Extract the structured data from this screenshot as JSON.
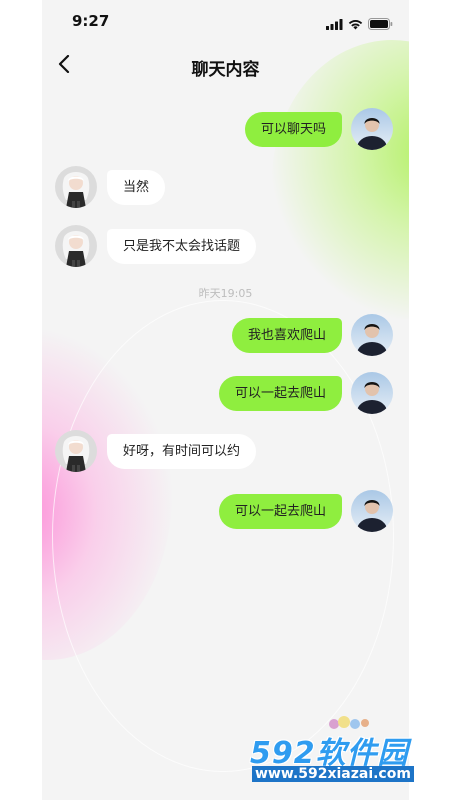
{
  "status_bar": {
    "time": "9:27",
    "icons": [
      "signal-icon",
      "wifi-icon",
      "battery-icon"
    ]
  },
  "nav": {
    "back_icon": "chevron-left-icon",
    "title": "聊天内容"
  },
  "messages": [
    {
      "side": "right",
      "avatar": "avatar-boy",
      "text": "可以聊天吗"
    },
    {
      "side": "left",
      "avatar": "avatar-girl",
      "text": "当然"
    },
    {
      "side": "left",
      "avatar": "avatar-girl",
      "text": "只是我不太会找话题"
    },
    {
      "side": "right",
      "avatar": "avatar-boy",
      "text": "我也喜欢爬山"
    },
    {
      "side": "right",
      "avatar": "avatar-boy",
      "text": "可以一起去爬山"
    },
    {
      "side": "left",
      "avatar": "avatar-girl",
      "text": "好呀，有时间可以约"
    },
    {
      "side": "right",
      "avatar": "avatar-boy",
      "text": "可以一起去爬山"
    }
  ],
  "timestamp": "昨天19:05",
  "watermark": {
    "title": "592软件园",
    "url": "www.592xiazai.com"
  },
  "colors": {
    "outgoing_bubble": "#8fee3f",
    "incoming_bubble": "#ffffff",
    "background": "#f4f4f4",
    "timestamp_text": "#bdbdbd"
  }
}
